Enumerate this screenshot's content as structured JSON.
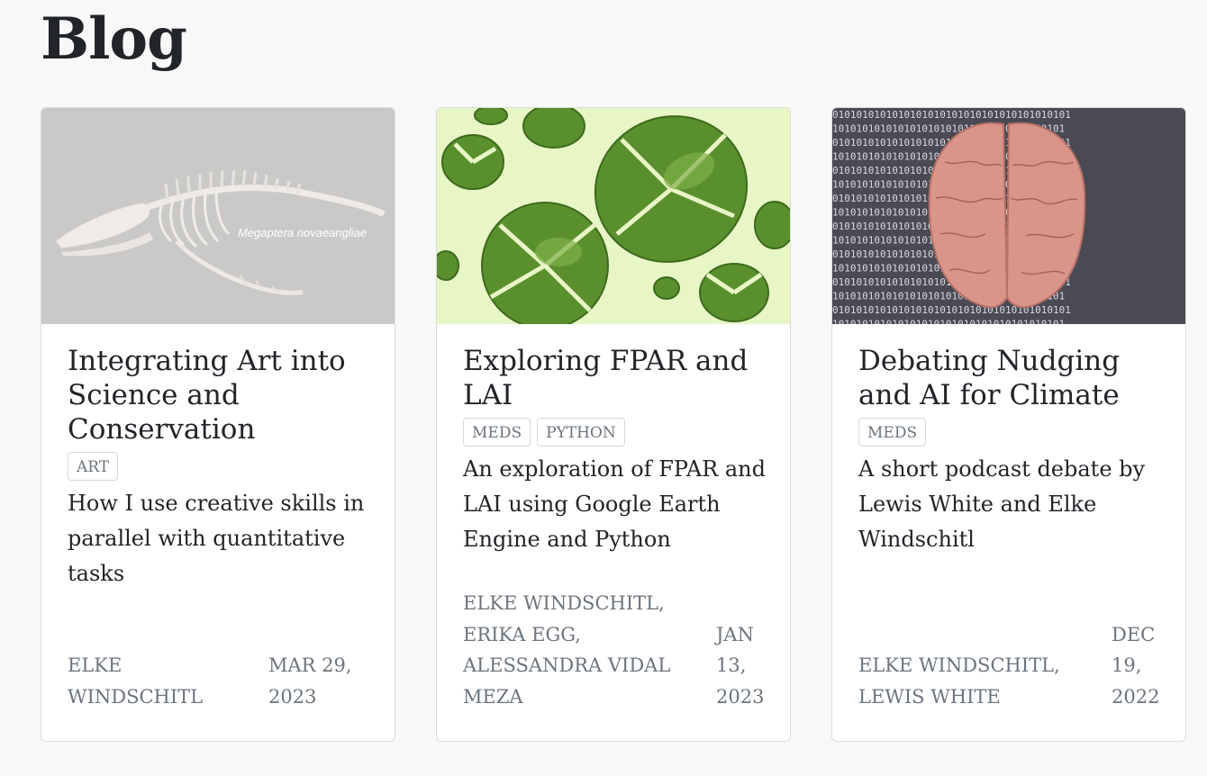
{
  "page": {
    "title": "Blog"
  },
  "posts": [
    {
      "title": "Integrating Art into Science and Conservation",
      "tags": [
        "ART"
      ],
      "description": "How I use creative skills in parallel with quantitative tasks",
      "author": "ELKE WINDSCHITL",
      "date": "MAR 29, 2023",
      "image_caption": "Megaptera novaeangliae",
      "image": "whale-skeleton-illustration"
    },
    {
      "title": "Exploring FPAR and LAI",
      "tags": [
        "MEDS",
        "PYTHON"
      ],
      "description": "An exploration of FPAR and LAI using Google Earth Engine and Python",
      "author": "ELKE WINDSCHITL, ERIKA EGG, ALESSANDRA VIDAL MEZA",
      "date": "JAN 13, 2023",
      "image": "monstera-leaves-pattern"
    },
    {
      "title": "Debating Nudging and AI for Climate",
      "tags": [
        "MEDS"
      ],
      "description": "A short podcast debate by Lewis White and Elke Windschitl",
      "author": "ELKE WINDSCHITL, LEWIS WHITE",
      "date": "DEC 19, 2022",
      "image": "brain-on-binary-background",
      "binary_text": "0101010101010101010101010101010101010101"
    }
  ]
}
